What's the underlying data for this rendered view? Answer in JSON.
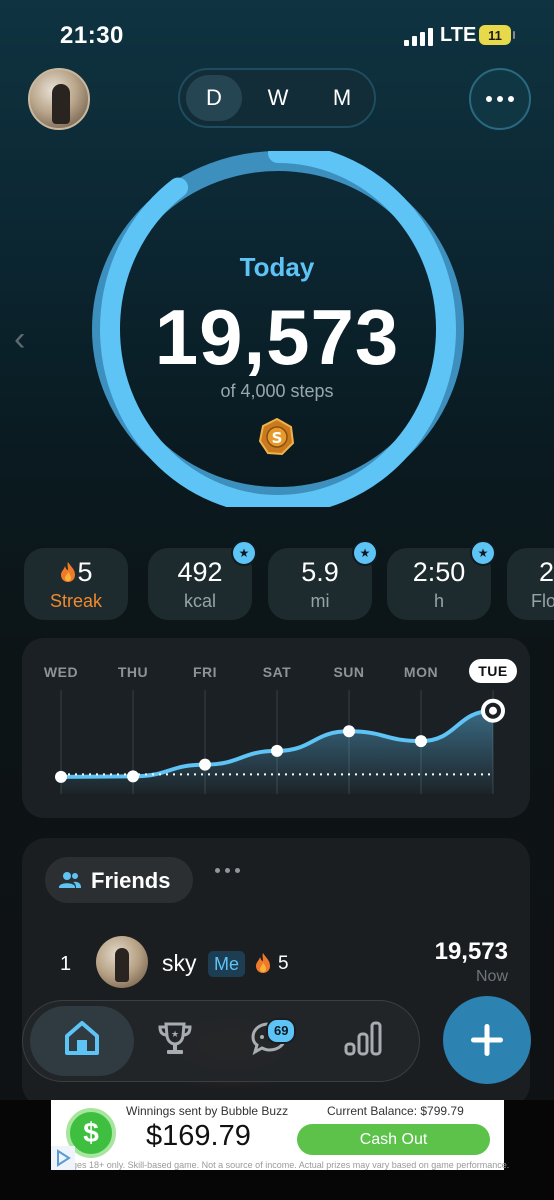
{
  "status_bar": {
    "time": "21:30",
    "network": "LTE",
    "battery": "11"
  },
  "header": {
    "segments": [
      {
        "label": "D",
        "selected": true
      },
      {
        "label": "W",
        "selected": false
      },
      {
        "label": "M",
        "selected": false
      }
    ],
    "more_icon": "ellipsis-icon"
  },
  "progress": {
    "period_label": "Today",
    "steps": "19,573",
    "goal_text": "of 4,000 steps",
    "ring_fraction": 1.0,
    "accent_color": "#5ec3f5"
  },
  "stats": [
    {
      "value": "5",
      "label": "Streak",
      "icon": "flame-icon",
      "starred": false
    },
    {
      "value": "492",
      "label": "kcal",
      "starred": true
    },
    {
      "value": "5.9",
      "label": "mi",
      "starred": true
    },
    {
      "value": "2:50",
      "label": "h",
      "starred": true
    },
    {
      "value": "2",
      "label": "Flo",
      "starred": false
    }
  ],
  "chart_data": {
    "type": "line",
    "categories": [
      "WED",
      "THU",
      "FRI",
      "SAT",
      "SUN",
      "MON",
      "TUE"
    ],
    "selected": "TUE",
    "series": [
      {
        "values": [
          3500,
          3600,
          6000,
          8800,
          12800,
          10800,
          17000
        ]
      }
    ],
    "goal_line": 4000,
    "ylim": [
      0,
      20000
    ]
  },
  "friends": {
    "title": "Friends",
    "entries": [
      {
        "rank": "1",
        "name": "sky",
        "tag": "Me",
        "streak": "5",
        "steps": "19,573",
        "updated": "Now"
      }
    ]
  },
  "tab_bar": {
    "tabs": [
      "home-icon",
      "trophy-icon",
      "chat-icon",
      "stats-icon"
    ],
    "chat_badge": "69",
    "add_icon": "plus-icon"
  },
  "ad": {
    "headline": "Winnings sent by Bubble Buzz",
    "balance": "Current Balance: $799.79",
    "amount": "$169.79",
    "cta": "Cash Out",
    "disclaimer": "Ages 18+ only. Skill-based game. Not a source of income. Actual prizes may vary based on game performance."
  }
}
